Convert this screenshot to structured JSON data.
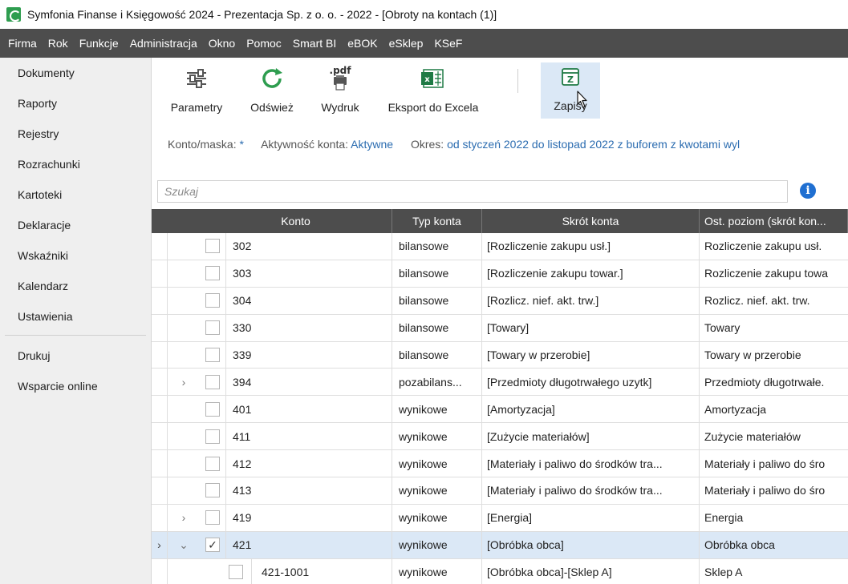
{
  "window": {
    "title": "Symfonia Finanse i Księgowość 2024 - Prezentacja Sp. z o. o. - 2022 - [Obroty na kontach (1)]"
  },
  "menu": [
    "Firma",
    "Rok",
    "Funkcje",
    "Administracja",
    "Okno",
    "Pomoc",
    "Smart BI",
    "eBOK",
    "eSklep",
    "KSeF"
  ],
  "sidebar": {
    "items": [
      "Dokumenty",
      "Raporty",
      "Rejestry",
      "Rozrachunki",
      "Kartoteki",
      "Deklaracje",
      "Wskaźniki",
      "Kalendarz",
      "Ustawienia"
    ],
    "bottom": [
      "Drukuj",
      "Wsparcie online"
    ]
  },
  "toolbar": {
    "parametry": "Parametry",
    "odswiez": "Odśwież",
    "wydruk": "Wydruk",
    "eksport": "Eksport do Excela",
    "zapisy": "Zapisy",
    "pdf_glyph": ".pdf"
  },
  "filters": {
    "konto_label": "Konto/maska:",
    "konto_value": "*",
    "aktywnosc_label": "Aktywność konta:",
    "aktywnosc_value": "Aktywne",
    "okres_label": "Okres:",
    "okres_value": "od styczeń 2022 do listopad 2022 z buforem z kwotami wyl"
  },
  "search": {
    "placeholder": "Szukaj"
  },
  "grid": {
    "headers": {
      "konto": "Konto",
      "typ": "Typ konta",
      "skrot": "Skrót konta",
      "ost": "Ost. poziom (skrót kon..."
    },
    "rows": [
      {
        "konto": "302",
        "typ": "bilansowe",
        "skrot": "[Rozliczenie zakupu usł.]",
        "ost": "Rozliczenie zakupu usł.",
        "expand": "",
        "checked": "",
        "gutter": ""
      },
      {
        "konto": "303",
        "typ": "bilansowe",
        "skrot": "[Rozliczenie zakupu towar.]",
        "ost": "Rozliczenie zakupu towa",
        "expand": "",
        "checked": "",
        "gutter": ""
      },
      {
        "konto": "304",
        "typ": "bilansowe",
        "skrot": "[Rozlicz. nief. akt. trw.]",
        "ost": "Rozlicz. nief. akt. trw.",
        "expand": "",
        "checked": "",
        "gutter": ""
      },
      {
        "konto": "330",
        "typ": "bilansowe",
        "skrot": "[Towary]",
        "ost": "Towary",
        "expand": "",
        "checked": "",
        "gutter": ""
      },
      {
        "konto": "339",
        "typ": "bilansowe",
        "skrot": "[Towary w przerobie]",
        "ost": "Towary w przerobie",
        "expand": "",
        "checked": "",
        "gutter": ""
      },
      {
        "konto": "394",
        "typ": "pozabilans...",
        "skrot": "[Przedmioty długotrwałego uzytk]",
        "ost": "Przedmioty długotrwałe.",
        "expand": "›",
        "checked": "",
        "gutter": ""
      },
      {
        "konto": "401",
        "typ": "wynikowe",
        "skrot": "[Amortyzacja]",
        "ost": "Amortyzacja",
        "expand": "",
        "checked": "",
        "gutter": ""
      },
      {
        "konto": "411",
        "typ": "wynikowe",
        "skrot": "[Zużycie materiałów]",
        "ost": "Zużycie materiałów",
        "expand": "",
        "checked": "",
        "gutter": ""
      },
      {
        "konto": "412",
        "typ": "wynikowe",
        "skrot": "[Materiały i paliwo do środków tra...",
        "ost": "Materiały i paliwo do śro",
        "expand": "",
        "checked": "",
        "gutter": ""
      },
      {
        "konto": "413",
        "typ": "wynikowe",
        "skrot": "[Materiały i paliwo do środków tra...",
        "ost": "Materiały i paliwo do śro",
        "expand": "",
        "checked": "",
        "gutter": ""
      },
      {
        "konto": "419",
        "typ": "wynikowe",
        "skrot": "[Energia]",
        "ost": "Energia",
        "expand": "›",
        "checked": "",
        "gutter": ""
      },
      {
        "konto": "421",
        "typ": "wynikowe",
        "skrot": "[Obróbka obca]",
        "ost": "Obróbka obca",
        "expand": "⌄",
        "checked": "✓",
        "gutter": "›",
        "selected": true
      },
      {
        "konto": "421-1001",
        "typ": "wynikowe",
        "skrot": "[Obróbka obca]-[Sklep A]",
        "ost": "Sklep A",
        "expand": "",
        "checked": "",
        "gutter": "",
        "sub": true
      }
    ]
  },
  "colors": {
    "menubar": "#4d4d4d",
    "link": "#2b6cb0",
    "selected_row": "#dbe8f6",
    "refresh": "#2e9d4f",
    "excel": "#1f7a45"
  }
}
